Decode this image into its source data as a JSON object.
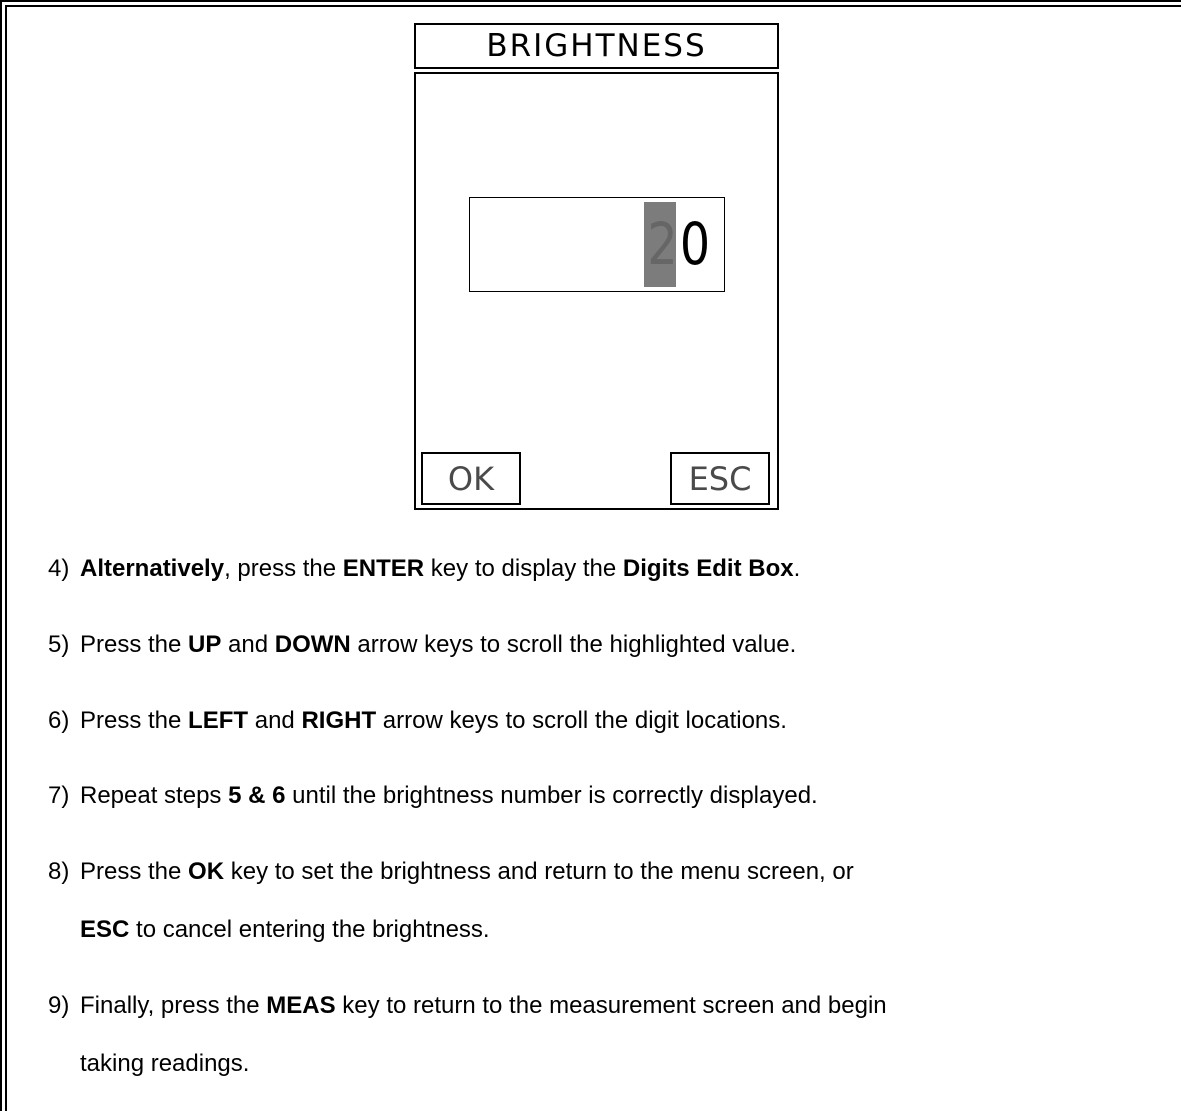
{
  "dialog": {
    "title": "BRIGHTNESS",
    "digits": {
      "highlighted": "2",
      "plain": "0"
    },
    "ok_label": "OK",
    "esc_label": "ESC"
  },
  "steps": [
    {
      "number": "4)",
      "parts": [
        {
          "t": "Alternatively",
          "b": true
        },
        {
          "t": ", press the ",
          "b": false
        },
        {
          "t": "ENTER",
          "b": true
        },
        {
          "t": " key to display the ",
          "b": false
        },
        {
          "t": "Digits Edit Box",
          "b": true
        },
        {
          "t": ".",
          "b": false
        }
      ]
    },
    {
      "number": "5)",
      "parts": [
        {
          "t": "Press the ",
          "b": false
        },
        {
          "t": "UP",
          "b": true
        },
        {
          "t": " and ",
          "b": false
        },
        {
          "t": "DOWN",
          "b": true
        },
        {
          "t": " arrow keys to scroll the highlighted value.",
          "b": false
        }
      ]
    },
    {
      "number": "6)",
      "parts": [
        {
          "t": "Press the ",
          "b": false
        },
        {
          "t": "LEFT",
          "b": true
        },
        {
          "t": " and ",
          "b": false
        },
        {
          "t": "RIGHT",
          "b": true
        },
        {
          "t": " arrow keys to scroll the digit locations.",
          "b": false
        }
      ]
    },
    {
      "number": "7)",
      "parts": [
        {
          "t": " Repeat steps ",
          "b": false
        },
        {
          "t": "5 & 6",
          "b": true
        },
        {
          "t": " until the brightness number is correctly displayed.",
          "b": false
        }
      ]
    },
    {
      "number": "8)",
      "parts": [
        {
          "t": "Press the ",
          "b": false
        },
        {
          "t": "OK",
          "b": true
        },
        {
          "t": " key to set the brightness and return to the menu screen, or",
          "b": false
        }
      ],
      "continuation": [
        {
          "t": "ESC",
          "b": true
        },
        {
          "t": " to cancel entering the brightness.",
          "b": false
        }
      ]
    },
    {
      "number": "9)",
      "parts": [
        {
          "t": "Finally, press the ",
          "b": false
        },
        {
          "t": "MEAS",
          "b": true
        },
        {
          "t": " key to return to the measurement screen and begin",
          "b": false
        }
      ],
      "continuation": [
        {
          "t": "taking readings.",
          "b": false
        }
      ]
    }
  ]
}
